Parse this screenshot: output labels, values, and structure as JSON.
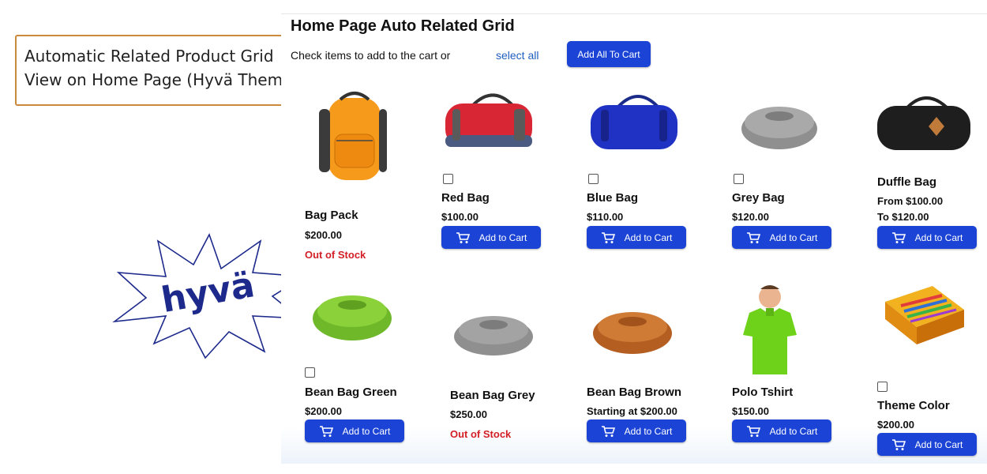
{
  "caption": {
    "line1": "Automatic Related Product Grid",
    "line2": "View on Home Page (Hyvä Themes)"
  },
  "logo": {
    "text": "hyvä",
    "color": "#1d2a8c"
  },
  "panel": {
    "title": "Home Page Auto Related Grid",
    "check_text": "Check items to add to the cart or",
    "select_all": "select all",
    "add_all": "Add All To Cart"
  },
  "cart_label": "Add to Cart",
  "accent_color": "#1b44d6",
  "out_of_stock_color": "#d21f26",
  "products": [
    {
      "name": "Bag Pack",
      "price": "$200.00",
      "status": "Out of Stock",
      "image": "backpack-icon"
    },
    {
      "name": "Red Bag",
      "price": "$100.00",
      "image": "red-duffle-icon"
    },
    {
      "name": "Blue Bag",
      "price": "$110.00",
      "image": "blue-duffle-icon"
    },
    {
      "name": "Grey Bag",
      "price": "$120.00",
      "image": "grey-beanbag-icon"
    },
    {
      "name": "Duffle Bag",
      "price_from": "From $100.00",
      "price_to": "To $120.00",
      "image": "black-duffle-icon"
    },
    {
      "name": "Bean Bag Green",
      "price": "$200.00",
      "image": "green-beanbag-icon"
    },
    {
      "name": "Bean Bag Grey",
      "price": "$250.00",
      "status": "Out of Stock",
      "image": "grey-beanbag-icon"
    },
    {
      "name": "Bean Bag Brown",
      "price": "Starting at $200.00",
      "image": "brown-beanbag-icon"
    },
    {
      "name": "Polo Tshirt",
      "price": "$150.00",
      "image": "polo-tshirt-icon"
    },
    {
      "name": "Theme Color",
      "price": "$200.00",
      "image": "color-boxes-icon"
    }
  ]
}
